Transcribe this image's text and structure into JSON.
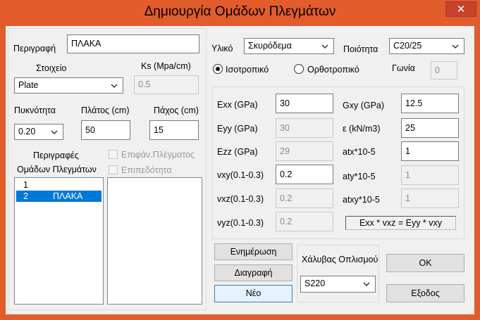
{
  "window": {
    "title": "Δημιουργία Ομάδων Πλεγμάτων"
  },
  "left": {
    "description_label": "Περιγραφή",
    "description_value": "ΠΛΑΚΑ",
    "element_label": "Στοιχείο",
    "element_value": "Plate",
    "ks_label": "Ks (Mpa/cm)",
    "ks_value": "0.5",
    "density_label": "Πυκνότητα",
    "density_value": "0.20",
    "width_label": "Πλάτος (cm)",
    "width_value": "50",
    "thickness_label": "Πάχος (cm)",
    "thickness_value": "15",
    "desc_list_label_line1": "Περιγραφές",
    "desc_list_label_line2": "Ομάδων Πλεγμάτων",
    "surface_checkbox_label": "Επιφάν.Πλέγματος",
    "flatness_checkbox_label": "Επιπεδότητα",
    "groups": [
      {
        "id": "1",
        "name": ""
      },
      {
        "id": "2",
        "name": "ΠΛΑΚΑ"
      }
    ]
  },
  "material": {
    "material_label": "Υλικό",
    "material_value": "Σκυρόδεμα",
    "quality_label": "Ποιότητα",
    "quality_value": "C20/25",
    "isotropic_label": "Ισοτροπικό",
    "orthotropic_label": "Ορθοτροπικό",
    "angle_label": "Γωνία",
    "angle_value": "0"
  },
  "props": {
    "exx_label": "Exx (GPa)",
    "exx_value": "30",
    "eyy_label": "Eyy (GPa)",
    "eyy_value": "30",
    "ezz_label": "Ezz (GPa)",
    "ezz_value": "29",
    "vxy_label": "vxy(0.1-0.3)",
    "vxy_value": "0.2",
    "vxz_label": "vxz(0.1-0.3)",
    "vxz_value": "0.2",
    "vyz_label": "vyz(0.1-0.3)",
    "vyz_value": "0.2",
    "gxy_label": "Gxy (GPa)",
    "gxy_value": "12.5",
    "e_label": "ε (kN/m3)",
    "e_value": "25",
    "atx_label": "atx*10-5",
    "atx_value": "1",
    "aty_label": "aty*10-5",
    "aty_value": "1",
    "atxy_label": "atxy*10-5",
    "atxy_value": "1",
    "formula": "Exx * vxz = Eyy * vxy"
  },
  "buttons": {
    "update": "Ενημέρωση",
    "delete": "Διαγραφή",
    "new": "Νέο",
    "ok": "OK",
    "exit": "Εξοδος"
  },
  "steel": {
    "label": "Χάλυβας Οπλισμού",
    "value": "S220"
  }
}
